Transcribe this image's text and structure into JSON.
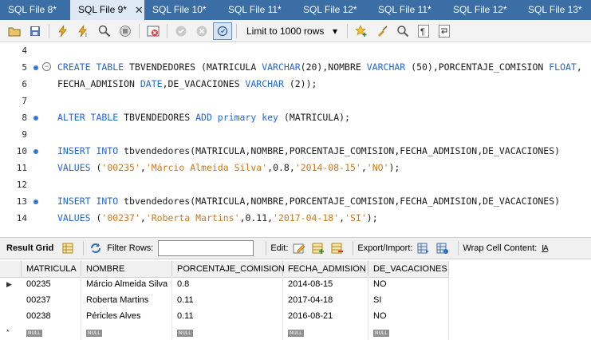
{
  "tabs": [
    {
      "label": "SQL File 8*"
    },
    {
      "label": "SQL File 9*",
      "active": true,
      "close": "✕"
    },
    {
      "label": "SQL File 10*"
    },
    {
      "label": "SQL File 11*"
    },
    {
      "label": "SQL File 12*"
    },
    {
      "label": "SQL File 11*"
    },
    {
      "label": "SQL File 12*"
    },
    {
      "label": "SQL File 13*"
    }
  ],
  "toolbar": {
    "limit_label": "Limit to 1000 rows",
    "limit_arrow": "▾"
  },
  "editor": {
    "lines": [
      {
        "n": "4",
        "dot": false
      },
      {
        "n": "5",
        "dot": true,
        "fold": "−"
      },
      {
        "n": "6",
        "dot": false
      },
      {
        "n": "7",
        "dot": false
      },
      {
        "n": "8",
        "dot": true
      },
      {
        "n": "9",
        "dot": false
      },
      {
        "n": "10",
        "dot": true
      },
      {
        "n": "11",
        "dot": false
      },
      {
        "n": "12",
        "dot": false
      },
      {
        "n": "13",
        "dot": true
      },
      {
        "n": "14",
        "dot": false
      }
    ],
    "code": {
      "l5": [
        {
          "t": "CREATE TABLE ",
          "c": "kw"
        },
        {
          "t": "TBVENDEDORES (MATRICULA ",
          "c": ""
        },
        {
          "t": "VARCHAR",
          "c": "kw"
        },
        {
          "t": "(20),NOMBRE ",
          "c": ""
        },
        {
          "t": "VARCHAR",
          "c": "kw"
        },
        {
          "t": " (50),PORCENTAJE_COMISION ",
          "c": ""
        },
        {
          "t": "FLOAT",
          "c": "kw"
        },
        {
          "t": ",",
          "c": ""
        }
      ],
      "l6": [
        {
          "t": "FECHA_ADMISION ",
          "c": ""
        },
        {
          "t": "DATE",
          "c": "kw"
        },
        {
          "t": ",DE_VACACIONES ",
          "c": ""
        },
        {
          "t": "VARCHAR",
          "c": "kw"
        },
        {
          "t": " (2));",
          "c": ""
        }
      ],
      "l8": [
        {
          "t": "ALTER TABLE ",
          "c": "kw"
        },
        {
          "t": "TBVENDEDORES ",
          "c": ""
        },
        {
          "t": "ADD primary key ",
          "c": "kw"
        },
        {
          "t": "(MATRICULA);",
          "c": ""
        }
      ],
      "l10": [
        {
          "t": "INSERT INTO ",
          "c": "kw"
        },
        {
          "t": "tbvendedores(MATRICULA,NOMBRE,PORCENTAJE_COMISION,FECHA_ADMISION,DE_VACACIONES)",
          "c": ""
        }
      ],
      "l11": [
        {
          "t": "VALUES ",
          "c": "kw"
        },
        {
          "t": "(",
          "c": ""
        },
        {
          "t": "'00235'",
          "c": "str"
        },
        {
          "t": ",",
          "c": ""
        },
        {
          "t": "'Márcio Almeida Silva'",
          "c": "str"
        },
        {
          "t": ",0.8,",
          "c": ""
        },
        {
          "t": "'2014-08-15'",
          "c": "str"
        },
        {
          "t": ",",
          "c": ""
        },
        {
          "t": "'NO'",
          "c": "str"
        },
        {
          "t": ");",
          "c": ""
        }
      ],
      "l13": [
        {
          "t": "INSERT INTO ",
          "c": "kw"
        },
        {
          "t": "tbvendedores(MATRICULA,NOMBRE,PORCENTAJE_COMISION,FECHA_ADMISION,DE_VACACIONES)",
          "c": ""
        }
      ],
      "l14": [
        {
          "t": "VALUES ",
          "c": "kw"
        },
        {
          "t": "(",
          "c": ""
        },
        {
          "t": "'00237'",
          "c": "str"
        },
        {
          "t": ",",
          "c": ""
        },
        {
          "t": "'Roberta Martins'",
          "c": "str"
        },
        {
          "t": ",0.11,",
          "c": ""
        },
        {
          "t": "'2017-04-18'",
          "c": "str"
        },
        {
          "t": ",",
          "c": ""
        },
        {
          "t": "'SI'",
          "c": "str"
        },
        {
          "t": ");",
          "c": ""
        }
      ]
    }
  },
  "result": {
    "grid_label": "Result Grid",
    "filter_label": "Filter Rows:",
    "filter_value": "",
    "edit_label": "Edit:",
    "export_label": "Export/Import:",
    "wrap_label": "Wrap Cell Content:",
    "wrap_icon": "IA",
    "columns": [
      "MATRICULA",
      "NOMBRE",
      "PORCENTAJE_COMISION",
      "FECHA_ADMISION",
      "DE_VACACIONES"
    ],
    "rows": [
      [
        "00235",
        "Márcio Almeida Silva",
        "0.8",
        "2014-08-15",
        "NO"
      ],
      [
        "00237",
        "Roberta Martins",
        "0.11",
        "2017-04-18",
        "SI"
      ],
      [
        "00238",
        "Péricles Alves",
        "0.11",
        "2016-08-21",
        "NO"
      ]
    ],
    "null_text": "NULL",
    "current_row_marker": "▶",
    "new_row_marker": "*"
  },
  "colors": {
    "tab_strip": "#3a6ea5",
    "keyword": "#2567d0",
    "string": "#c77a1d",
    "breakpoint_dot": "#2e7cd6"
  }
}
